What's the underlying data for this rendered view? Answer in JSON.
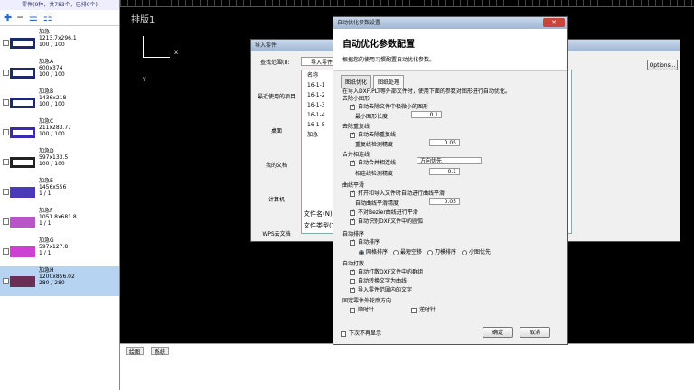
{
  "left": {
    "header": "零件(9种，共783个，已排0个)",
    "parts": [
      {
        "name": "加急",
        "size": "1213.7x296.1",
        "qty": "100 / 100"
      },
      {
        "name": "加急A",
        "size": "600x374",
        "qty": "100 / 100"
      },
      {
        "name": "加急B",
        "size": "1436x218",
        "qty": "100 / 100"
      },
      {
        "name": "加急C",
        "size": "211x283.77",
        "qty": "100 / 100"
      },
      {
        "name": "加急D",
        "size": "597x133.5",
        "qty": "100 / 100"
      },
      {
        "name": "加急E",
        "size": "1456x556",
        "qty": "1 / 1"
      },
      {
        "name": "加急F",
        "size": "1051.8x681.8",
        "qty": "1 / 1"
      },
      {
        "name": "加急G",
        "size": "597x127.8",
        "qty": "1 / 1"
      },
      {
        "name": "加急H",
        "size": "1200x856.02",
        "qty": "280 / 280"
      }
    ]
  },
  "canvas": {
    "title": "排版1",
    "axis": "X",
    "yaxis": "Y"
  },
  "bottom": {
    "tab1": "绘图",
    "tab2": "系统"
  },
  "import": {
    "title": "导入零件",
    "lookin": "查找范围(I):",
    "folder": "导入零件",
    "col": "名称",
    "side": [
      "最近使用的项目",
      "桌面",
      "我的文档",
      "计算机",
      "WPS云文档"
    ],
    "files": [
      "16-1-1",
      "16-1-2",
      "16-1-3",
      "16-1-4",
      "16-1-5",
      "加急"
    ],
    "fname": "文件名(N):",
    "ftype": "文件类型(T):",
    "options": "Options..."
  },
  "opt": {
    "title": "自动优化参数设置",
    "heading": "自动优化参数配置",
    "sub": "根据您的使用习惯配置自动优化参数。",
    "tab1": "图纸优化",
    "tab2": "图纸处理",
    "intro": "在导入DXF,PLT等外部文件时，使用下面的参数对图形进行自动优化。",
    "s1": "去除小图形",
    "s1a": "自动去除文件中极微小的图形",
    "s1b": "最小图形长度",
    "s1v": "0.1",
    "s2": "去除重复线",
    "s2a": "自动去除重复线",
    "s2b": "重复线检测精度",
    "s2v": "0.05",
    "s3": "合并相连线",
    "s3a": "自动合并相连线",
    "s3d": "方向优先",
    "s3b": "相连线检测精度",
    "s3v": "0.1",
    "s4": "曲线平滑",
    "s4a": "打开和导入文件时自动进行曲线平滑",
    "s4b": "自动曲线平滑精度",
    "s4v": "0.05",
    "s4c": "不对Bezier曲线进行平滑",
    "s4d": "自动识别DXF文件中的圆弧",
    "s5": "自动排序",
    "s5a": "自动排序",
    "r1": "网格排序",
    "r2": "最短空移",
    "r3": "刀模排序",
    "r4": "小图优先",
    "s6": "自动打散",
    "s6a": "自动打散DXF文件中的群组",
    "s6b": "自动转换文字为曲线",
    "s6c": "导入零件范围内的文字",
    "s7": "固定零件外轮廓方向",
    "s7a": "顺时针",
    "s7b": "逆时针",
    "noshow": "下次不再显示",
    "ok": "确定",
    "cancel": "取消"
  }
}
